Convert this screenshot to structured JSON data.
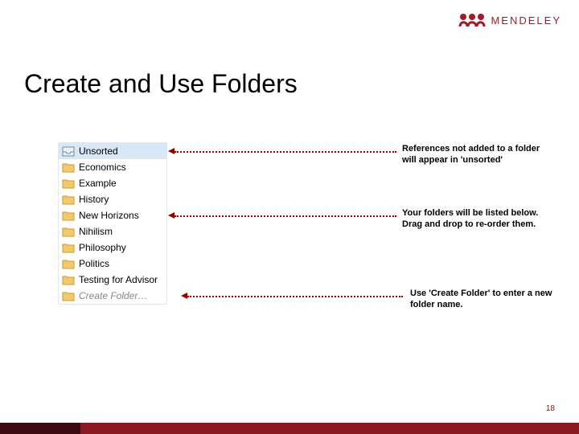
{
  "brand": {
    "name": "MENDELEY"
  },
  "title": "Create and Use Folders",
  "folders": [
    {
      "label": "Unsorted",
      "type": "unsorted",
      "selected": true
    },
    {
      "label": "Economics",
      "type": "folder"
    },
    {
      "label": "Example",
      "type": "folder"
    },
    {
      "label": "History",
      "type": "folder"
    },
    {
      "label": "New Horizons",
      "type": "folder"
    },
    {
      "label": "Nihilism",
      "type": "folder"
    },
    {
      "label": "Philosophy",
      "type": "folder"
    },
    {
      "label": "Politics",
      "type": "folder"
    },
    {
      "label": "Testing for Advisor",
      "type": "folder"
    },
    {
      "label": "Create Folder…",
      "type": "create"
    }
  ],
  "annotations": {
    "unsorted": "References not added to a folder will appear in 'unsorted'",
    "list": "Your folders will be listed below. Drag and drop to re-order them.",
    "create": "Use 'Create Folder' to enter a new folder name."
  },
  "page_number": "18"
}
